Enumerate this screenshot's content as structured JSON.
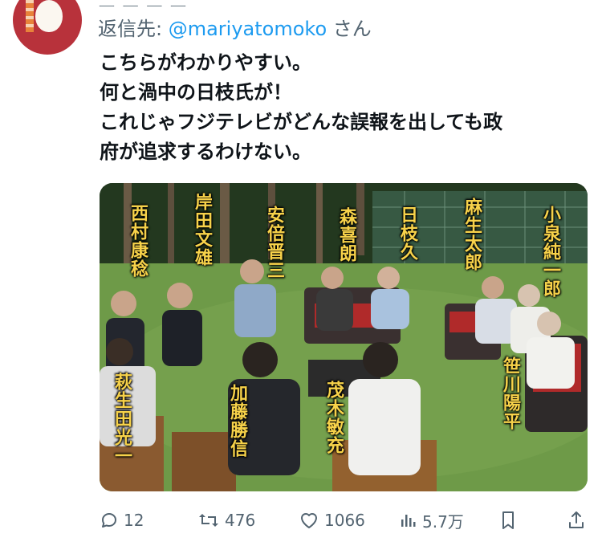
{
  "author": {
    "truncated_name": "ー ー ー ー"
  },
  "reply": {
    "prefix": "返信先: ",
    "mention": "@mariyatomoko",
    "suffix": " さん"
  },
  "tweet": {
    "lines": [
      "こちらがわかりやすい。",
      "何と渦中の日枝氏が！",
      "これじゃフジテレビがどんな誤報を出しても政",
      "府が追求するわけない。"
    ]
  },
  "media": {
    "captions": [
      "西村康稔",
      "岸田文雄",
      "安倍晋三",
      "森喜朗",
      "日枝久",
      "麻生太郎",
      "小泉純一郎",
      "萩生田光一",
      "加藤勝信",
      "茂木敏充",
      "笹川陽平"
    ]
  },
  "actions": {
    "replies": "12",
    "reposts": "476",
    "likes": "1066",
    "views": "5.7万"
  },
  "colors": {
    "link": "#1d9bf0",
    "secondary": "#536471",
    "caption": "#f7d24a"
  }
}
